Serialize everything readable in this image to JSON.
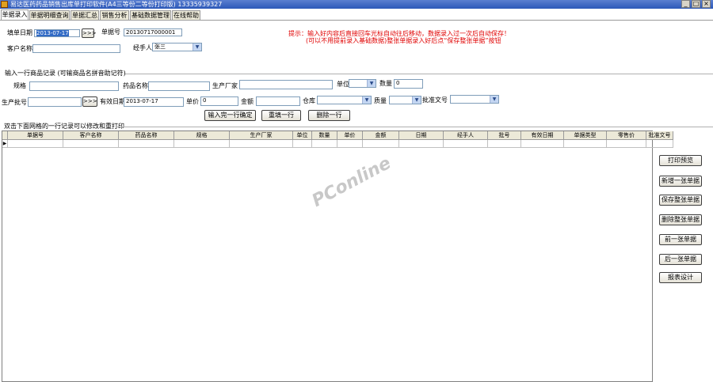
{
  "window": {
    "title": "易达医药药品销售出库单打印软件(A4三等份二等份打印版) 13335939327"
  },
  "tabs": [
    {
      "label": "单据录入",
      "active": true
    },
    {
      "label": "单据明细查询"
    },
    {
      "label": "单据汇总"
    },
    {
      "label": "销售分析"
    },
    {
      "label": "基础数据管理"
    },
    {
      "label": "在线帮助"
    }
  ],
  "header": {
    "date_label": "填单日期",
    "date_value": "2013-07-17",
    "date_btn": ">>>",
    "bill_no_label": "单据号",
    "bill_no_value": "20130717000001",
    "customer_label": "客户名称",
    "customer_value": "",
    "handler_label": "经手人",
    "handler_value": "张三"
  },
  "hint": {
    "line1": "提示：输入好内容后直接回车光标自动往后移动，数据录入过一次后自动保存！",
    "line2": "(可以不用提前录入基础数据)整张单据录入好后点“保存整张单据”按钮"
  },
  "entry": {
    "section_label": "输入一行商品记录 (可输商品名拼音助记符)",
    "spec_label": "规格",
    "drug_name_label": "药品名称",
    "manufacturer_label": "生产厂家",
    "unit_label": "单位",
    "qty_label": "数量",
    "qty_value": "0",
    "batch_label": "生产批号",
    "batch_btn": ">>>",
    "expiry_label": "有效日期",
    "expiry_value": "2013-07-17",
    "price_label": "单价",
    "price_value": "0",
    "amount_label": "金额",
    "warehouse_label": "仓库",
    "quality_label": "质量",
    "approval_label": "批准文号",
    "confirm_btn": "输入完一行确定",
    "refill_btn": "重填一行",
    "delete_btn": "删除一行"
  },
  "grid": {
    "caption": "双击下面网格的一行记录可以修改和重打印",
    "columns": [
      "单据号",
      "客户名称",
      "药品名称",
      "规格",
      "生产厂家",
      "单位",
      "数量",
      "单价",
      "金额",
      "日期",
      "经手人",
      "批号",
      "有效日期",
      "单据类型",
      "零售价",
      "批准文号"
    ]
  },
  "side_buttons": [
    "打印预览",
    "新增一张单据",
    "保存整张单据",
    "删除整张单据",
    "前一张单据",
    "后一张单据",
    "报表设计"
  ],
  "watermark": "PConline 太平洋电脑网"
}
